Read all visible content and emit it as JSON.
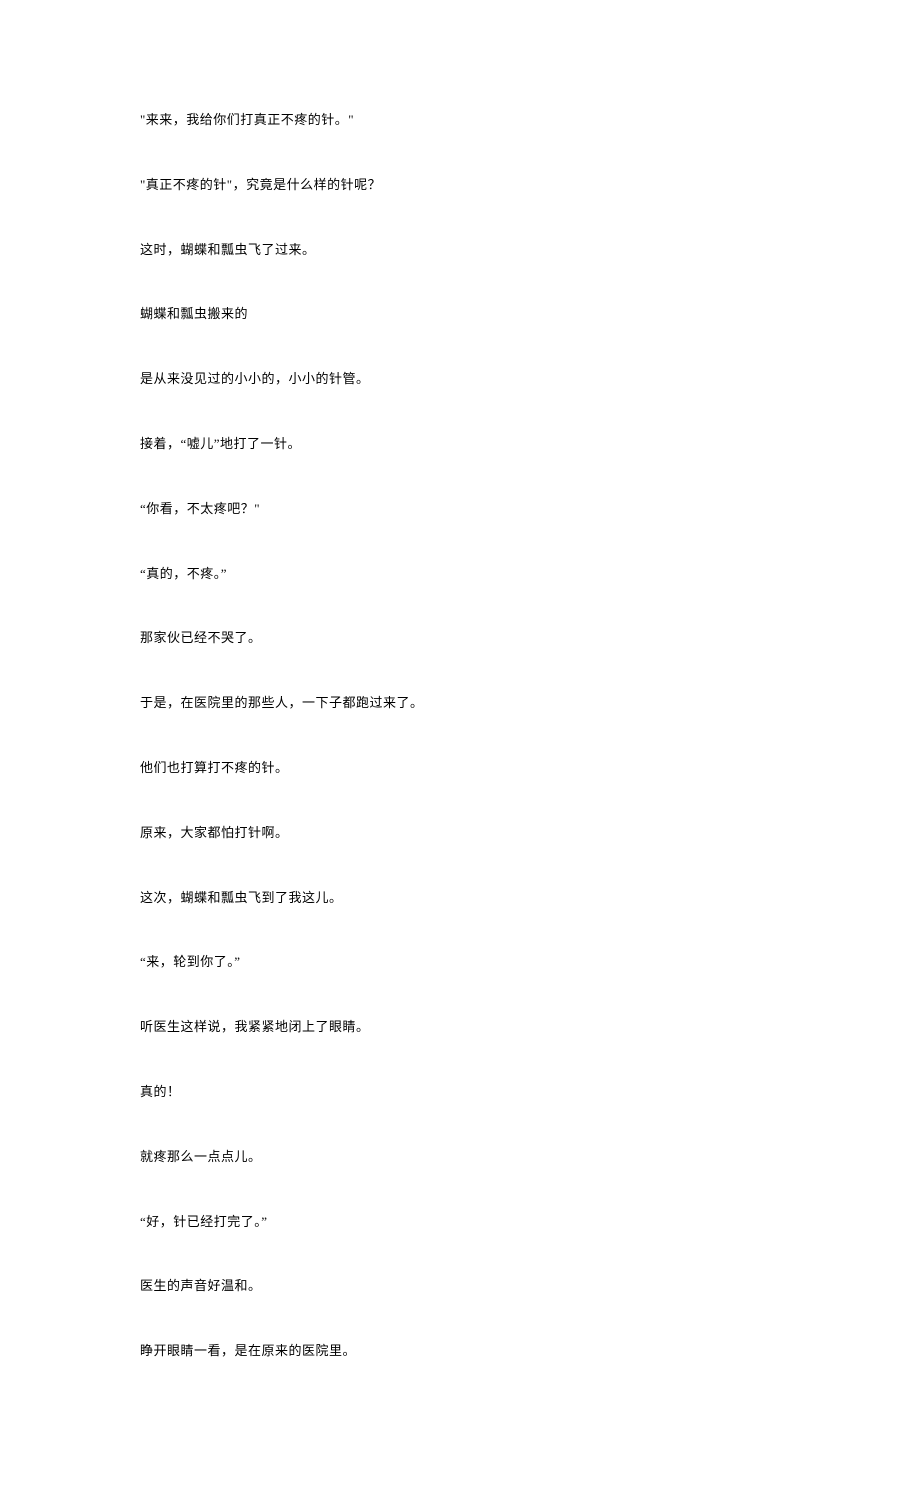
{
  "lines": [
    "\"来来，我给你们打真正不疼的针。\"",
    "\"真正不疼的针\"，究竟是什么样的针呢？",
    "这时，蝴蝶和瓢虫飞了过来。",
    "蝴蝶和瓢虫搬来的",
    "是从来没见过的小小的，小小的针管。",
    "接着，“嘘儿”地打了一针。",
    "“你看，不太疼吧？\"",
    "“真的，不疼。”",
    "那家伙已经不哭了。",
    "于是，在医院里的那些人，一下子都跑过来了。",
    "他们也打算打不疼的针。",
    "原来，大家都怕打针啊。",
    "这次，蝴蝶和瓢虫飞到了我这儿。",
    "“来，轮到你了。”",
    "听医生这样说，我紧紧地闭上了眼睛。",
    "真的！",
    "就疼那么一点点儿。",
    "“好，针已经打完了。”",
    "医生的声音好温和。",
    "睁开眼睛一看，是在原来的医院里。"
  ]
}
